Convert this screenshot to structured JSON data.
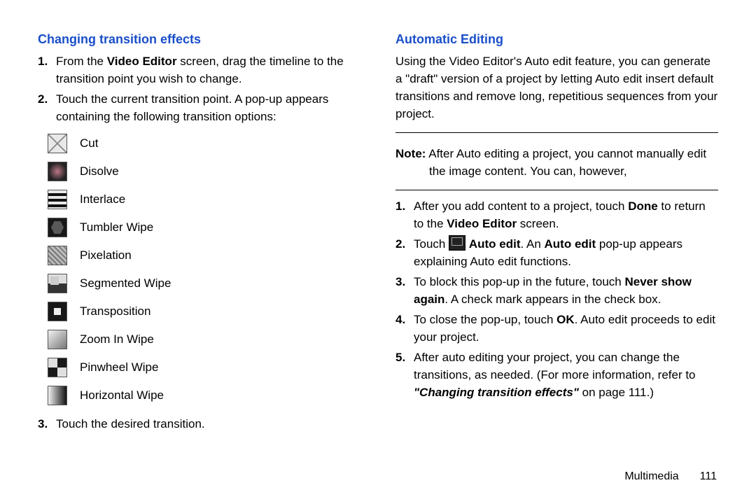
{
  "left": {
    "heading": "Changing transition effects",
    "step1_pre": "From the ",
    "step1_bold": "Video Editor",
    "step1_post": " screen, drag the timeline to the transition point you wish to change.",
    "step2": "Touch the current transition point. A pop-up appears containing the following transition options:",
    "transitions": {
      "cut": "Cut",
      "disolve": "Disolve",
      "interlace": "Interlace",
      "tumbler": "Tumbler Wipe",
      "pixelation": "Pixelation",
      "segmented": "Segmented Wipe",
      "transposition": "Transposition",
      "zoom": "Zoom In Wipe",
      "pinwheel": "Pinwheel Wipe",
      "horizontal": "Horizontal Wipe"
    },
    "step3": "Touch the desired transition."
  },
  "right": {
    "heading": "Automatic Editing",
    "intro": "Using the Video Editor's Auto edit feature, you can generate a \"draft\" version of a project by letting Auto edit insert default transitions and remove long, repetitious sequences from your project.",
    "note_label": "Note:",
    "note_body": " After Auto editing a project, you cannot manually edit the image content. You can, however,",
    "step1_pre": "After you add content to a project, touch ",
    "step1_bold1": "Done",
    "step1_mid": " to return to the ",
    "step1_bold2": "Video Editor",
    "step1_post": " screen.",
    "step2_pre": "Touch ",
    "step2_bold1": "Auto edit",
    "step2_mid": ". An ",
    "step2_bold2": "Auto edit",
    "step2_post": " pop-up appears explaining Auto edit functions.",
    "step3_pre": "To block this pop-up in the future, touch ",
    "step3_bold": "Never show again",
    "step3_post": ". A check mark appears in the check box.",
    "step4_pre": "To close the pop-up, touch ",
    "step4_bold": "OK",
    "step4_post": ". Auto edit proceeds to edit your project.",
    "step5_pre": "After auto editing your project, you can change the transitions, as needed. (For more information, refer to ",
    "step5_bi": "\"Changing transition effects\"",
    "step5_post": " on page 111.)"
  },
  "footer": {
    "section": "Multimedia",
    "page": "111"
  }
}
